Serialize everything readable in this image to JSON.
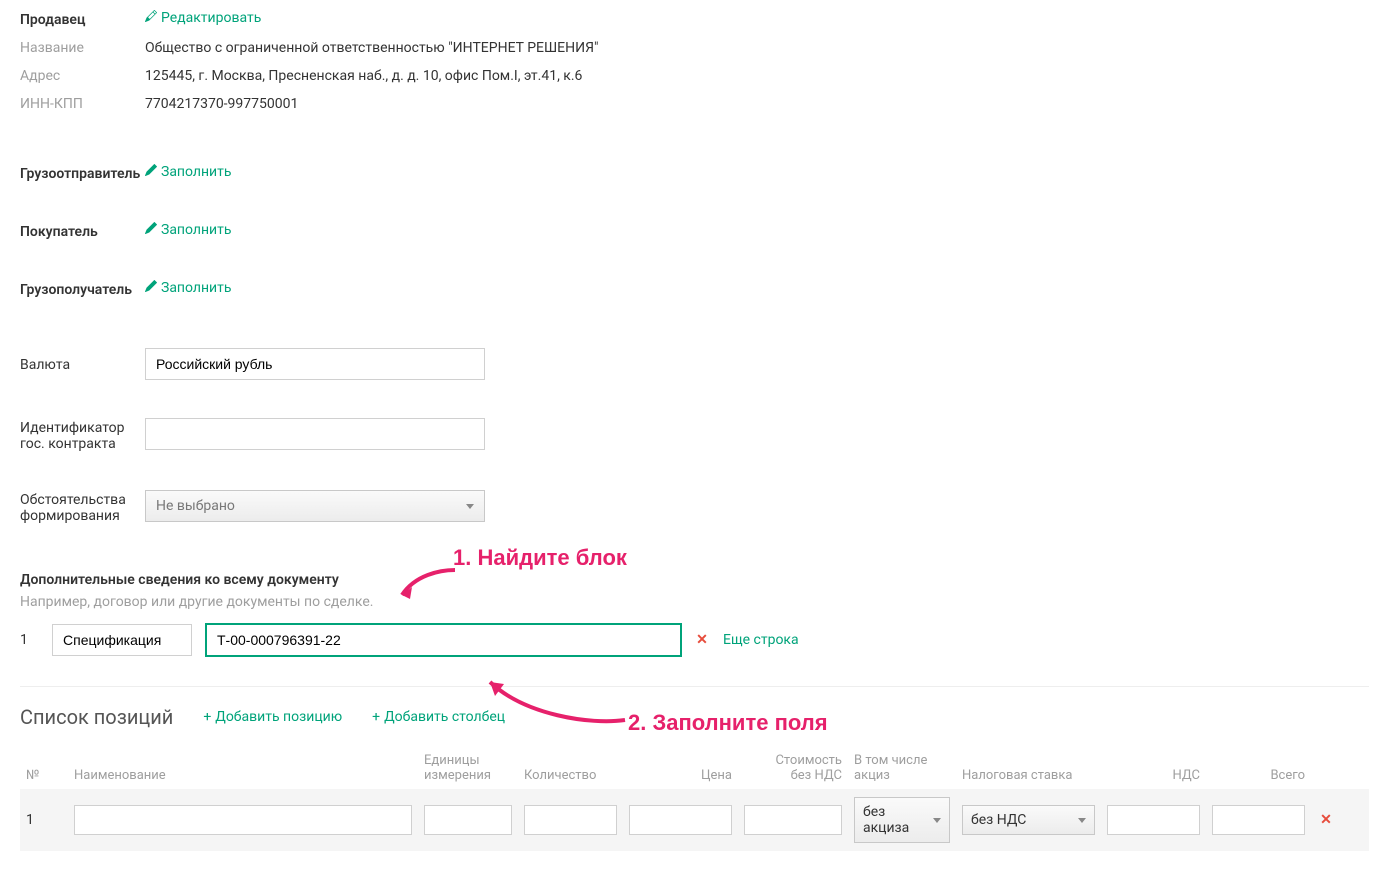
{
  "seller": {
    "label": "Продавец",
    "edit": "Редактировать",
    "name_label": "Название",
    "name_value": "Общество с ограниченной ответственностью \"ИНТЕРНЕТ РЕШЕНИЯ\"",
    "addr_label": "Адрес",
    "addr_value": "125445, г. Москва, Пресненская наб., д. д. 10, офис Пом.I, эт.41, к.6",
    "inn_label": "ИНН-КПП",
    "inn_value": "7704217370-997750001"
  },
  "shipper": {
    "label": "Грузоотправитель",
    "fill": "Заполнить"
  },
  "buyer": {
    "label": "Покупатель",
    "fill": "Заполнить"
  },
  "consignee": {
    "label": "Грузополучатель",
    "fill": "Заполнить"
  },
  "currency": {
    "label": "Валюта",
    "value": "Российский рубль"
  },
  "gos_id": {
    "label_line1": "Идентификатор",
    "label_line2": "гос. контракта",
    "value": ""
  },
  "circ": {
    "label_line1": "Обстоятельства",
    "label_line2": "формирования",
    "value": "Не выбрано"
  },
  "extra": {
    "title": "Дополнительные сведения ко всему документу",
    "hint": "Например, договор или другие документы по сделке.",
    "row_num": "1",
    "spec_label": "Спецификация",
    "spec_value": "Т-00-000796391-22",
    "more": "Еще строка"
  },
  "positions": {
    "title": "Список позиций",
    "add_pos": "Добавить позицию",
    "add_col": "Добавить столбец",
    "headers": {
      "num": "№",
      "name": "Наименование",
      "unit_l1": "Единицы",
      "unit_l2": "измерения",
      "qty": "Количество",
      "price": "Цена",
      "cost_l1": "Стоимость",
      "cost_l2": "без НДС",
      "excise": "В том числе акциз",
      "rate": "Налоговая ставка",
      "vat": "НДС",
      "total": "Всего"
    },
    "row": {
      "num": "1",
      "excise": "без акциза",
      "rate": "без НДС"
    }
  },
  "annotations": {
    "step1": "1. Найдите блок",
    "step2": "2. Заполните поля"
  }
}
